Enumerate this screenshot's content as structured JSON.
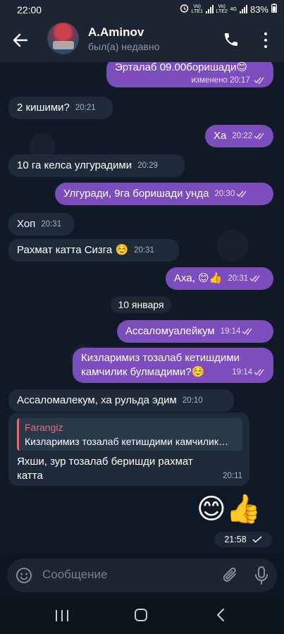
{
  "status_bar": {
    "time": "22:00",
    "sim1": "Vo) LTE1",
    "sim2": "Vo) LTE2",
    "net": "4G",
    "battery": "83%"
  },
  "header": {
    "name": "A.Aminov",
    "status": "был(а) недавно"
  },
  "messages": [
    {
      "dir": "out",
      "text": "Эрталаб 09.00боришади😊",
      "meta": "изменено 20:17",
      "read": true
    },
    {
      "dir": "in",
      "text": "2 кишими?",
      "meta": "20:21"
    },
    {
      "dir": "out",
      "text": "Ха",
      "meta": "20:22",
      "read": true
    },
    {
      "dir": "in",
      "text": "10 га келса улгурадими",
      "meta": "20:29"
    },
    {
      "dir": "out",
      "text": "Улгуради, 9га боришади унда",
      "meta": "20:30",
      "read": true
    },
    {
      "dir": "in",
      "text": "Хоп",
      "meta": "20:31"
    },
    {
      "dir": "in",
      "text": "Рахмат катта Сизга ☺️",
      "meta": "20:31"
    },
    {
      "dir": "out",
      "text": "Аха, 😊👍",
      "meta": "20:31",
      "read": true
    },
    {
      "dir": "out",
      "text": "Ассаломуалейкум",
      "meta": "19:14",
      "read": true
    },
    {
      "dir": "out",
      "text": "Кизларимиз тозалаб кетишдими",
      "text2": "камчилик булмадими?☺️",
      "meta": "19:14",
      "read": true
    },
    {
      "dir": "in",
      "text": "Ассаломалекум, ха рульда эдим",
      "meta": "20:10"
    },
    {
      "dir": "in",
      "reply_name": "Farangiz",
      "reply_text": "Кизларимиз тозалаб кетишдими камчилик булмадими?",
      "text": "Яхши, зур тозалаб беришди рахмат",
      "text2": "катта",
      "meta": "20:11"
    },
    {
      "dir": "out",
      "emoji": "😊👍",
      "meta": "21:58",
      "read": true
    }
  ],
  "date_separator": "10 января",
  "composer": {
    "placeholder": "Сообщение"
  },
  "colors": {
    "outgoing_bubble": "#7c4dbd",
    "incoming_bubble": "#1e2c3a",
    "background": "#0f1a26",
    "reply_accent": "#e36d7b"
  }
}
